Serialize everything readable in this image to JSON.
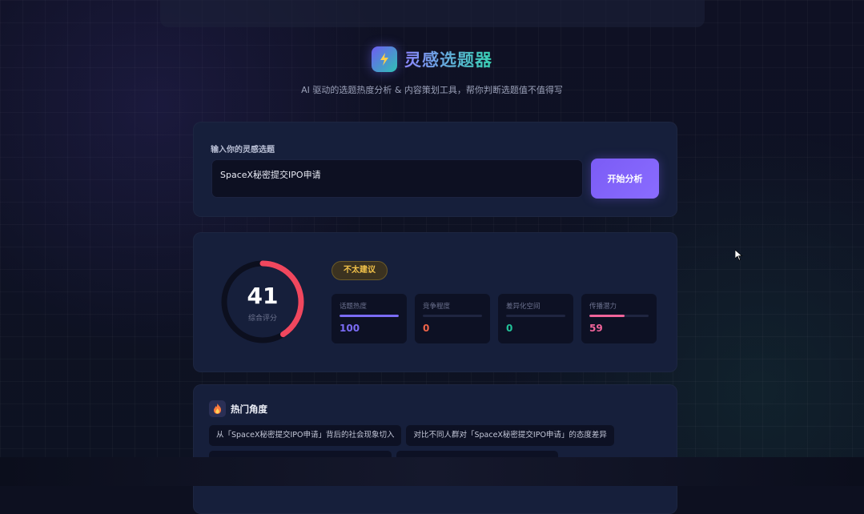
{
  "app": {
    "title": "灵感选题器",
    "subtitle": "AI 驱动的选题热度分析 & 内容策划工具，帮你判断选题值不值得写",
    "logo_icon": "lightning-icon"
  },
  "input_section": {
    "label": "输入你的灵感选题",
    "value": "SpaceX秘密提交IPO申请",
    "button_label": "开始分析"
  },
  "score": {
    "value": 41,
    "max": 100,
    "label": "综合评分",
    "verdict": "不太建议",
    "gauge_color": "#f0475e",
    "verdict_color": "#f2c24a",
    "metrics": [
      {
        "label": "话题热度",
        "value": 100,
        "color": "#7b6cf6"
      },
      {
        "label": "竞争程度",
        "value": 0,
        "color": "#f06449"
      },
      {
        "label": "差异化空间",
        "value": 0,
        "color": "#22c49a"
      },
      {
        "label": "传播潜力",
        "value": 59,
        "color": "#f0649a"
      }
    ]
  },
  "angles": {
    "title": "热门角度",
    "icon": "fire-icon",
    "items": [
      "从「SpaceX秘密提交IPO申请」背后的社会现象切入",
      "对比不同人群对「SpaceX秘密提交IPO申请」的态度差异"
    ]
  }
}
